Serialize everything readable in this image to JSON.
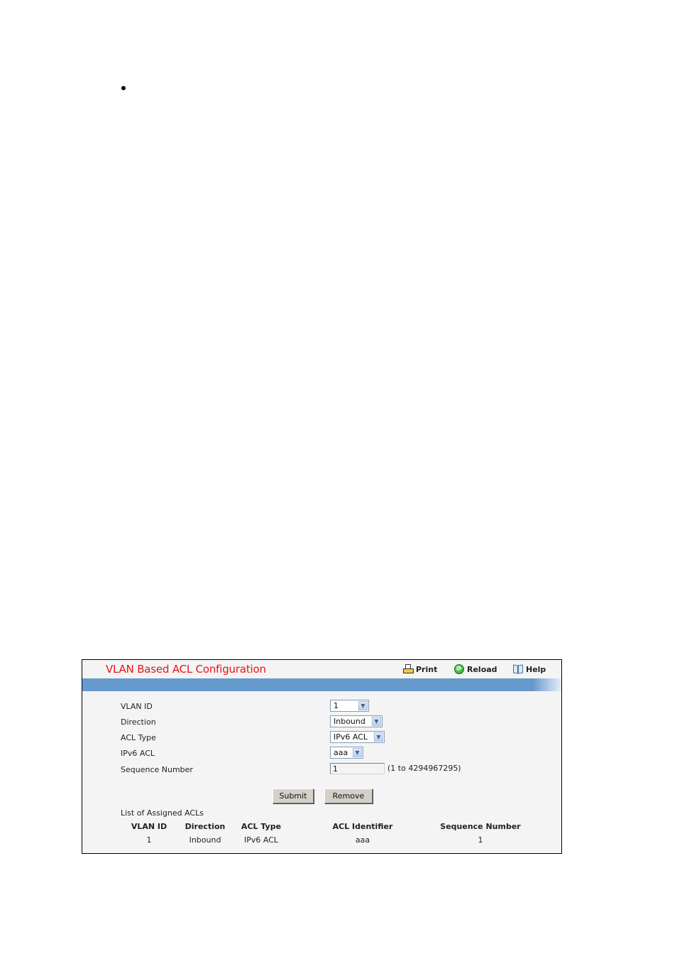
{
  "page": {
    "bullet": "•"
  },
  "panel": {
    "title": "VLAN Based ACL Configuration",
    "toolbar": {
      "print_label": "Print",
      "reload_label": "Reload",
      "help_label": "Help"
    },
    "form": {
      "vlan_id": {
        "label": "VLAN ID",
        "value": "1"
      },
      "direction": {
        "label": "Direction",
        "value": "Inbound"
      },
      "acl_type": {
        "label": "ACL Type",
        "value": "IPv6 ACL"
      },
      "ipv6_acl": {
        "label": "IPv6 ACL",
        "value": "aaa"
      },
      "sequence_number": {
        "label": "Sequence Number",
        "value": "1",
        "hint": "(1 to 4294967295)"
      }
    },
    "buttons": {
      "submit_label": "Submit",
      "remove_label": "Remove"
    },
    "assigned_list": {
      "title": "List of Assigned ACLs",
      "columns": [
        "VLAN ID",
        "Direction",
        "ACL Type",
        "ACL Identifier",
        "Sequence Number"
      ],
      "rows": [
        [
          "1",
          "Inbound",
          "IPv6 ACL",
          "aaa",
          "1"
        ]
      ]
    }
  }
}
